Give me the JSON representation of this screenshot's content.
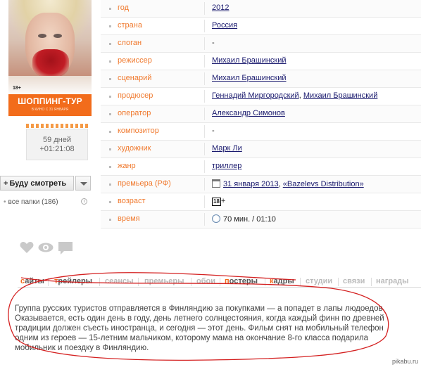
{
  "poster": {
    "age_rating": "18+",
    "title": "ШОППИНГ-ТУР",
    "subtitle": "В КИНО С 31 ЯНВАРЯ"
  },
  "countdown": {
    "days": "59 дней",
    "time": "+01:21:08"
  },
  "watch_button": {
    "label": "Буду смотреть"
  },
  "folders": {
    "label": "все папки (186)"
  },
  "info_rows": [
    {
      "label": "год",
      "value": "2012"
    },
    {
      "label": "страна",
      "value": "Россия"
    },
    {
      "label": "слоган",
      "value": "-"
    },
    {
      "label": "режиссер",
      "value": "Михаил Брашинский"
    },
    {
      "label": "сценарий",
      "value": "Михаил Брашинский"
    },
    {
      "label": "продюсер",
      "value_a": "Геннадий Миргородский",
      "value_b": "Михаил Брашинский"
    },
    {
      "label": "оператор",
      "value": "Александр Симонов"
    },
    {
      "label": "композитор",
      "value": "-"
    },
    {
      "label": "художник",
      "value": "Марк Ли"
    },
    {
      "label": "жанр",
      "value": "триллер"
    },
    {
      "label": "премьера (РФ)",
      "date": "31 января 2013",
      "distributor": "«Bazelevs Distribution»"
    },
    {
      "label": "возраст",
      "badge": "18",
      "suffix": "+"
    },
    {
      "label": "время",
      "value": "70 мин. / 01:10"
    }
  ],
  "tabs": [
    {
      "first": "с",
      "rest": "айты"
    },
    {
      "first": "т",
      "rest": "рейлеры"
    },
    {
      "first": "",
      "rest": "сеансы"
    },
    {
      "first": "",
      "rest": "премьеры"
    },
    {
      "first": "",
      "rest": "обои"
    },
    {
      "first": "п",
      "rest": "остеры"
    },
    {
      "first": "к",
      "rest": "адры"
    },
    {
      "first": "",
      "rest": "студии"
    },
    {
      "first": "",
      "rest": "связи"
    },
    {
      "first": "",
      "rest": "награды"
    }
  ],
  "description": "Группа русских туристов отправляется в Финляндию за покупками — а попадет в лапы людоедов. Оказывается, есть один день в году, день летнего солнцестояния, когда каждый финн по древней традиции должен съесть иностранца, и сегодня — этот день. Фильм снят на мобильный телефон одним из героев — 15-летним мальчиком, которому мама на окончание 8-го класса подарила мобильник и поездку в Финляндию.",
  "watermark": "pikabu.ru",
  "colors": {
    "accent": "#f07a2f",
    "link": "#1a1a6e",
    "annotation": "#d42020"
  }
}
